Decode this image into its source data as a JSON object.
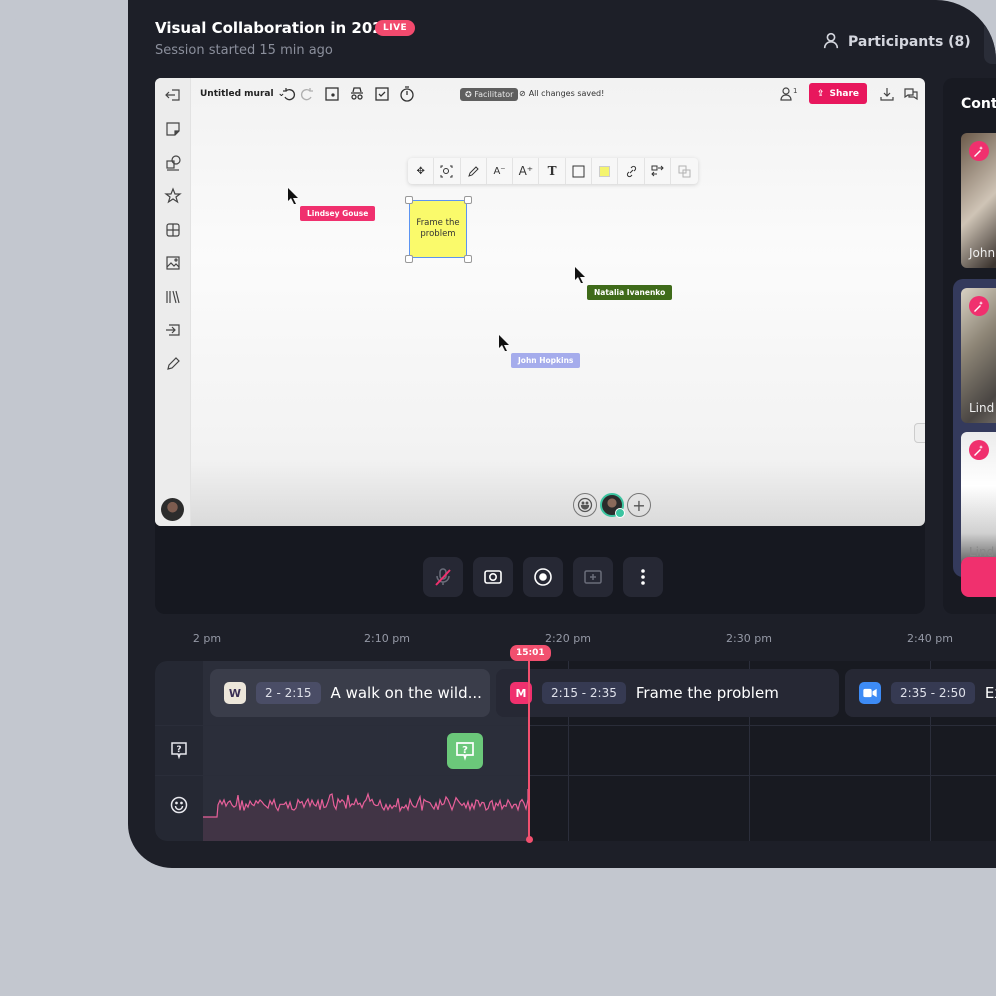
{
  "header": {
    "title": "Visual Collaboration in 2021",
    "live_badge": "LIVE",
    "subtitle": "Session started 15 min ago",
    "participants_label": "Participants (8)"
  },
  "mural": {
    "name": "Untitled mural",
    "facilitator_badge": "Facilitator",
    "save_status": "All changes saved!",
    "share_label": "Share",
    "user_count": "1",
    "left_tools": [
      "exit-icon",
      "sticky-note-icon",
      "shapes-icon",
      "star-icon",
      "grid-icon",
      "image-icon",
      "library-icon",
      "import-icon",
      "pen-icon"
    ],
    "top_tools": [
      "undo-icon",
      "redo-icon",
      "frame-icon",
      "incognito-icon",
      "checklist-icon",
      "timer-icon"
    ],
    "context_toolbar": [
      "move-icon",
      "zoom-fit-icon",
      "pencil-icon",
      "font-smaller-icon",
      "font-larger-icon",
      "text-icon",
      "border-icon",
      "color-swatch-icon",
      "link-icon",
      "swap-icon",
      "layer-icon"
    ],
    "sticky_note": {
      "text": "Frame the problem",
      "color": "#fafa6b"
    },
    "cursors": [
      {
        "name": "Lindsey Gouse",
        "color": "#f0306e"
      },
      {
        "name": "Natalia Ivanenko",
        "color": "#3f6b1a"
      },
      {
        "name": "John Hopkins",
        "color": "#a5acec"
      }
    ]
  },
  "controls": [
    "mic-muted-icon",
    "camera-icon",
    "record-icon",
    "screen-share-icon",
    "more-icon"
  ],
  "right_panel": {
    "title": "Cont",
    "tiles": [
      {
        "name": "John"
      },
      {
        "name": "Lind"
      },
      {
        "name": "Lind"
      }
    ],
    "add_label": "+"
  },
  "timeline": {
    "ticks": [
      "2 pm",
      "2:10 pm",
      "2:20 pm",
      "2:30 pm",
      "2:40 pm"
    ],
    "playhead": "15:01",
    "sessions": [
      {
        "time": "2 - 2:15",
        "title": "A walk on the wild...",
        "icon": "W",
        "icon_color": "#ece6da"
      },
      {
        "time": "2:15 - 2:35",
        "title": "Frame the problem",
        "icon": "M",
        "icon_color": "#f0306e"
      },
      {
        "time": "2:35 - 2:50",
        "title": "Ex",
        "icon": "video-icon",
        "icon_color": "#3d8bf5"
      }
    ],
    "rows": [
      "question-icon",
      "emoji-icon"
    ]
  },
  "colors": {
    "accent": "#f0306e",
    "live": "#f24a6e",
    "question_marker": "#6bc87a",
    "waveform": "#e8609a"
  }
}
